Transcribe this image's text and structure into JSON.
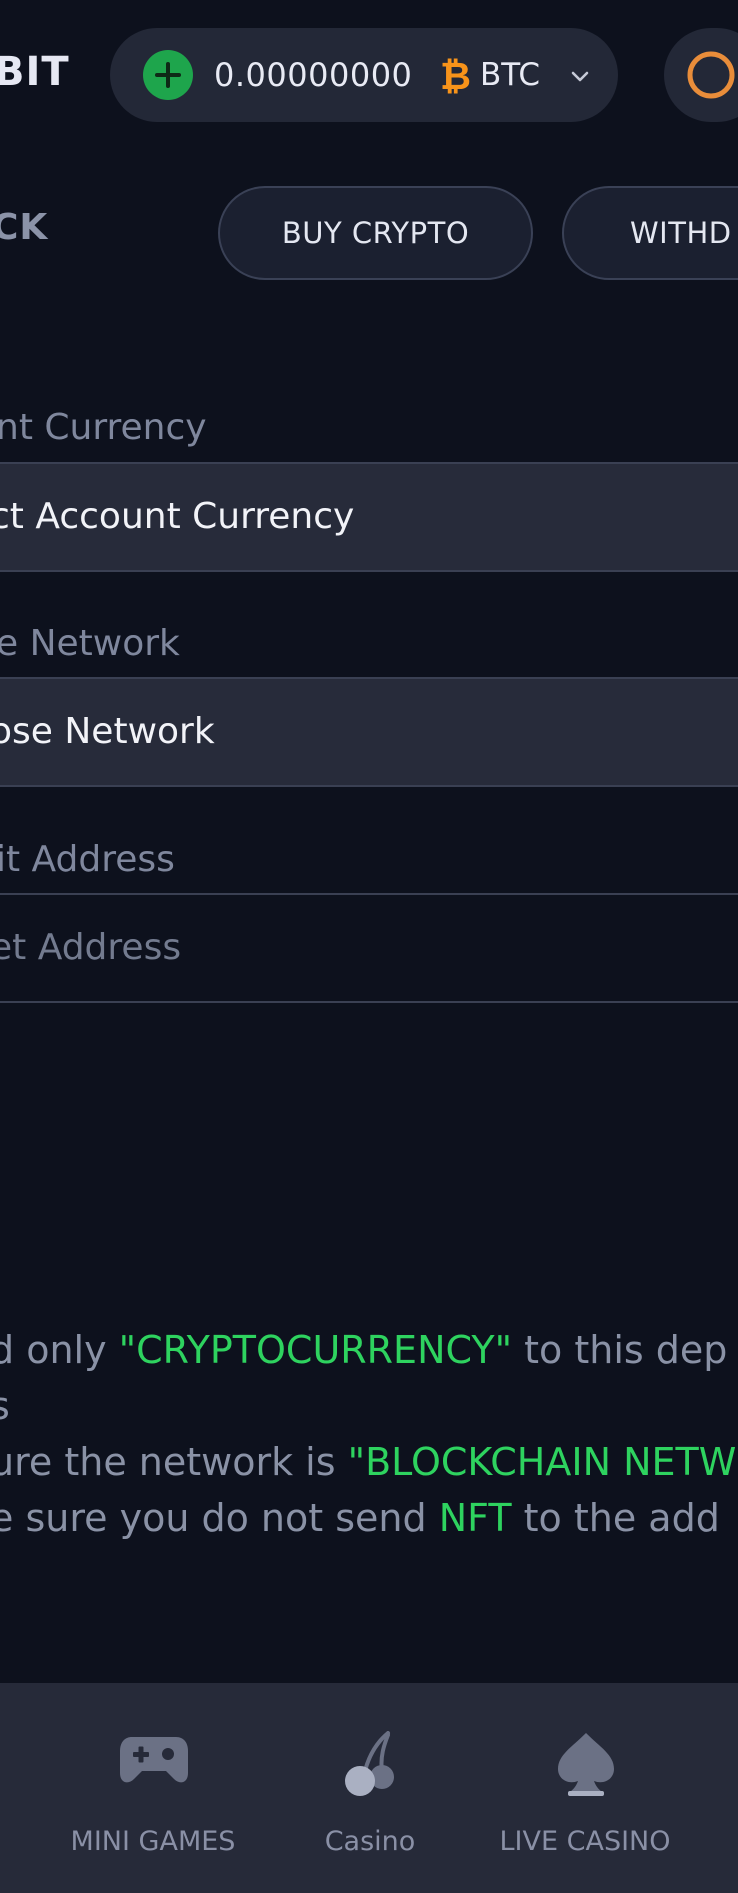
{
  "header": {
    "logo_text": "BIT",
    "balance": "0.00000000",
    "currency": "BTC",
    "icons": {
      "add": "plus-circle-icon",
      "coin": "bitcoin-icon",
      "dropdown": "chevron-down-icon",
      "avatar": "profile-icon"
    }
  },
  "subheader": {
    "back_label": "CK",
    "buy_label": "BUY CRYPTO",
    "withdraw_label": "WITHD"
  },
  "form": {
    "currency": {
      "label": "nt Currency",
      "value": "ct Account Currency"
    },
    "network": {
      "label": "e Network",
      "value": "ose Network"
    },
    "address": {
      "label": "it Address",
      "placeholder": "et Address"
    }
  },
  "notes": {
    "line1_prefix": "d only ",
    "line1_highlight": "\"CRYPTOCURRENCY\"",
    "line1_suffix": " to this dep",
    "line2": "s",
    "line3_prefix": "ure the network is ",
    "line3_highlight": "\"BLOCKCHAIN NETW",
    "line4_prefix": "e sure you do not send ",
    "line4_highlight": "NFT",
    "line4_suffix": " to the add"
  },
  "bottom_nav": {
    "items": [
      {
        "label": "MINI GAMES",
        "icon": "gamepad-icon"
      },
      {
        "label": "Casino",
        "icon": "cherry-icon"
      },
      {
        "label": "LIVE CASINO",
        "icon": "spade-icon"
      }
    ]
  },
  "colors": {
    "background": "#0d111d",
    "surface": "#232837",
    "accent_green": "#2ed35f",
    "bitcoin_orange": "#f7931a"
  }
}
